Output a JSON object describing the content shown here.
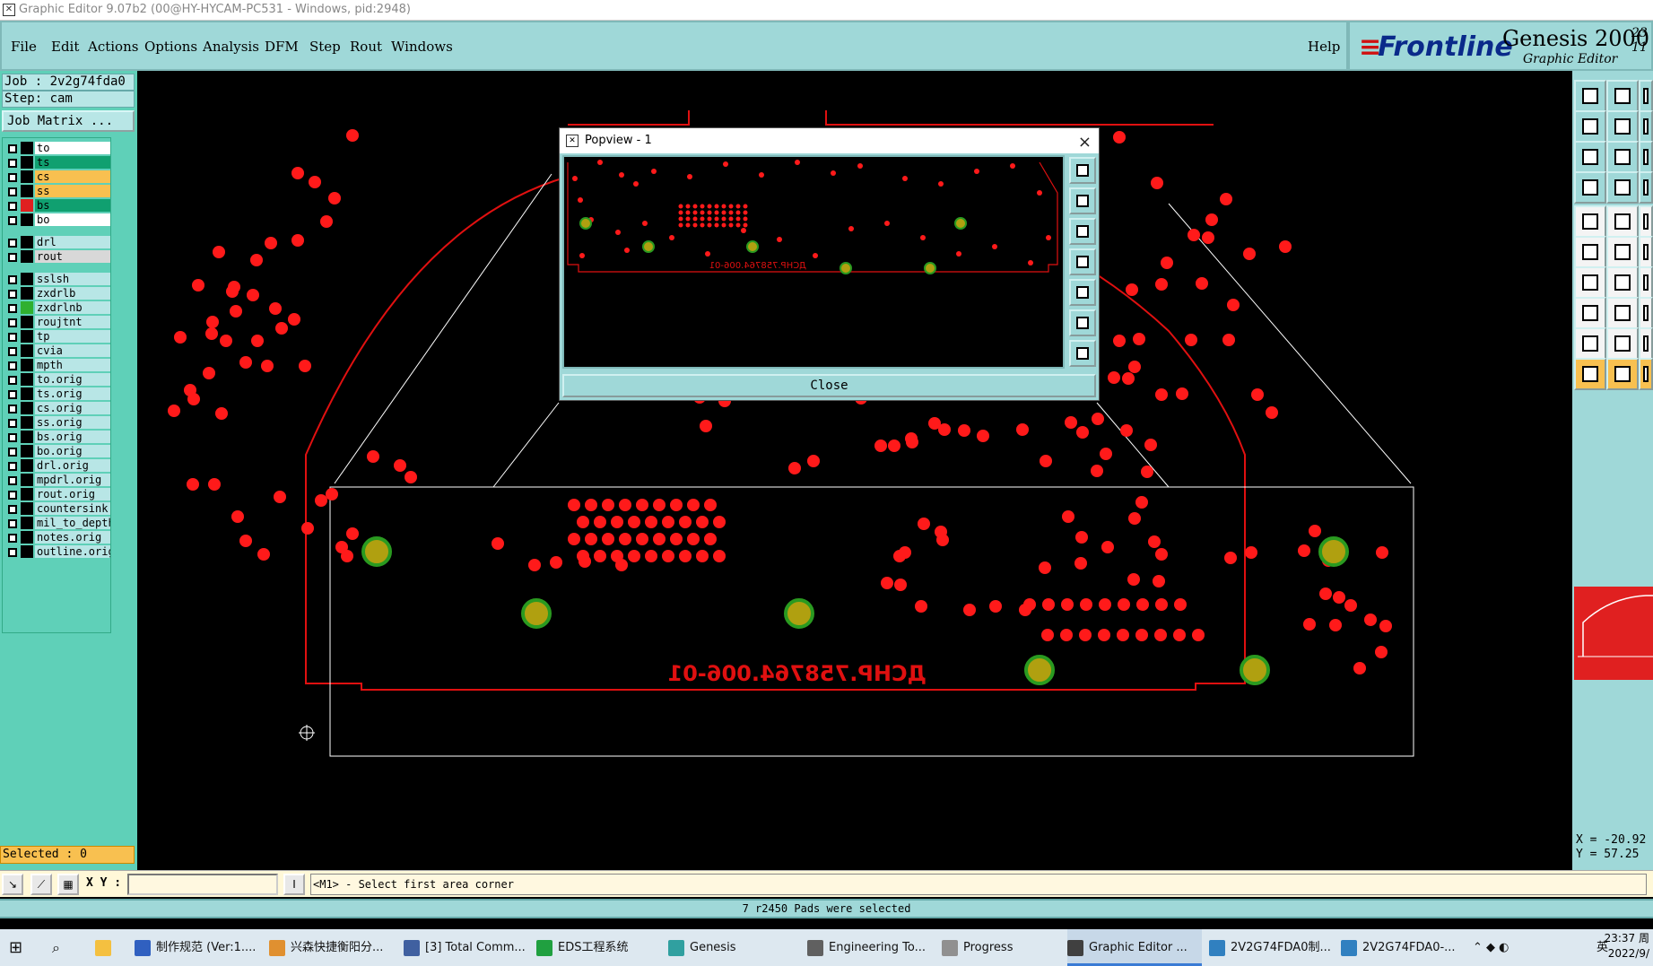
{
  "window": {
    "title": "Graphic Editor 9.07b2 (00@HY-HYCAM-PC531 - Windows, pid:2948)"
  },
  "menu": {
    "items": [
      "File",
      "Edit",
      "Actions",
      "Options",
      "Analysis",
      "DFM",
      "Step",
      "Rout",
      "Windows"
    ],
    "help": "Help"
  },
  "brand": {
    "logo": "Frontline",
    "product": "Genesis 2000",
    "subtitle": "Graphic Editor",
    "corner": "23 11"
  },
  "job": {
    "job_label": "Job : 2v2g74fda0",
    "step_label": "Step: cam",
    "matrix_button": "Job Matrix ..."
  },
  "layers": [
    {
      "name": "to",
      "bg": "#ffffff",
      "color": "#000000"
    },
    {
      "name": "ts",
      "bg": "#10a070",
      "color": "#000000"
    },
    {
      "name": "cs",
      "bg": "#f8c050",
      "color": "#000000"
    },
    {
      "name": "ss",
      "bg": "#f8c050",
      "color": "#000000"
    },
    {
      "name": "bs",
      "bg": "#10a070",
      "color": "#e02020"
    },
    {
      "name": "bo",
      "bg": "#ffffff",
      "color": "#000000"
    },
    {
      "name": "drl",
      "bg": "#b8e6e6",
      "color": "#000000"
    },
    {
      "name": "rout",
      "bg": "#d8d8d8",
      "color": "#000000"
    },
    {
      "name": "sslsh",
      "bg": "#b8e6e6",
      "color": "#000000"
    },
    {
      "name": "zxdrlb",
      "bg": "#b8e6e6",
      "color": "#000000"
    },
    {
      "name": "zxdrlnb",
      "bg": "#b8e6e6",
      "color": "#30b030"
    },
    {
      "name": "roujtnt",
      "bg": "#b8e6e6",
      "color": "#000000"
    },
    {
      "name": "tp",
      "bg": "#b8e6e6",
      "color": "#000000"
    },
    {
      "name": "cvia",
      "bg": "#b8e6e6",
      "color": "#000000"
    },
    {
      "name": "mpth",
      "bg": "#b8e6e6",
      "color": "#000000"
    },
    {
      "name": "to.orig",
      "bg": "#b8e6e6",
      "color": "#000000"
    },
    {
      "name": "ts.orig",
      "bg": "#b8e6e6",
      "color": "#000000"
    },
    {
      "name": "cs.orig",
      "bg": "#b8e6e6",
      "color": "#000000"
    },
    {
      "name": "ss.orig",
      "bg": "#b8e6e6",
      "color": "#000000"
    },
    {
      "name": "bs.orig",
      "bg": "#b8e6e6",
      "color": "#000000"
    },
    {
      "name": "bo.orig",
      "bg": "#b8e6e6",
      "color": "#000000"
    },
    {
      "name": "drl.orig",
      "bg": "#b8e6e6",
      "color": "#000000"
    },
    {
      "name": "mpdrl.orig",
      "bg": "#b8e6e6",
      "color": "#000000"
    },
    {
      "name": "rout.orig",
      "bg": "#b8e6e6",
      "color": "#000000"
    },
    {
      "name": "countersink",
      "bg": "#b8e6e6",
      "color": "#000000"
    },
    {
      "name": "mil_to_depth",
      "bg": "#b8e6e6",
      "color": "#000000"
    },
    {
      "name": "notes.orig",
      "bg": "#b8e6e6",
      "color": "#000000"
    },
    {
      "name": "outline.orig",
      "bg": "#b8e6e6",
      "color": "#000000"
    }
  ],
  "selected": "Selected : 0",
  "coords": {
    "x": "X = -20.92",
    "y": "Y = 57.25"
  },
  "board": {
    "text": "ДСНР.758764.006-01"
  },
  "popview": {
    "title": "Popview - 1",
    "close_label": "Close",
    "close_icon": "×"
  },
  "command": {
    "xy_label": "X Y :",
    "input_value": "",
    "prompt": "<M1> - Select first area corner"
  },
  "status": "7 r2450 Pads were selected",
  "taskbar": {
    "items": [
      "制作规范 (Ver:1....",
      "兴森快捷衡阳分...",
      "[3] Total Comm...",
      "EDS工程系统",
      "Genesis",
      "Engineering To...",
      "Progress",
      "Graphic Editor ...",
      "2V2G74FDA0制...",
      "2V2G74FDA0-..."
    ],
    "tray_lang": "英",
    "time": "23:37 周",
    "date": "2022/9/"
  },
  "colors": {
    "accent": "#9fd8d8",
    "panel": "#5fd0b8",
    "pad": "#ff1a1a",
    "via": "#b0a010",
    "outline": "#e01010"
  }
}
